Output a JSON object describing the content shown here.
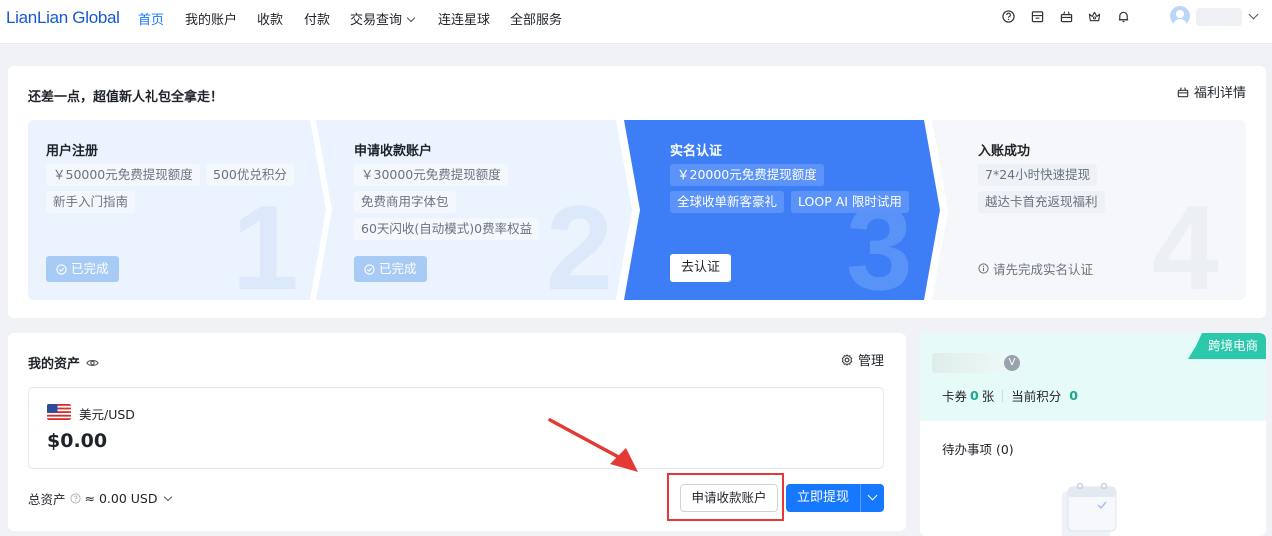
{
  "nav": {
    "logo": "LianLian Global",
    "items": [
      {
        "label": "首页",
        "active": true
      },
      {
        "label": "我的账户"
      },
      {
        "label": "收款"
      },
      {
        "label": "付款"
      },
      {
        "label": "交易查询"
      },
      {
        "label": "连连星球"
      },
      {
        "label": "全部服务"
      }
    ],
    "icons": [
      "help-icon",
      "calendar-icon",
      "gift-icon",
      "crown-icon",
      "bell-icon"
    ]
  },
  "onboard": {
    "title": "还差一点，超值新人礼包全拿走！",
    "welfare_label": "福利详情",
    "steps": [
      {
        "title": "用户注册",
        "tags": [
          "￥50000元免费提现额度",
          "500优兑积分",
          "新手入门指南"
        ],
        "status": "已完成",
        "num": "1"
      },
      {
        "title": "申请收款账户",
        "tags": [
          "￥30000元免费提现额度",
          "免费商用字体包",
          "60天闪收(自动模式)0费率权益"
        ],
        "status": "已完成",
        "num": "2"
      },
      {
        "title": "实名认证",
        "tags": [
          "￥20000元免费提现额度",
          "全球收单新客豪礼",
          "LOOP AI 限时试用"
        ],
        "action": "去认证",
        "num": "3"
      },
      {
        "title": "入账成功",
        "tags": [
          "7*24小时快速提现",
          "越达卡首充返现福利"
        ],
        "hint": "请先完成实名认证",
        "num": "4"
      }
    ]
  },
  "assets": {
    "title": "我的资产",
    "manage_label": "管理",
    "currency": "美元/USD",
    "amount": "$0.00",
    "total_label": "总资产",
    "total_value": "≈ 0.00 USD",
    "apply_button": "申请收款账户",
    "withdraw_button": "立即提现"
  },
  "rightpanel": {
    "badge": "跨境电商",
    "v_label": "V",
    "coupon_label": "卡券",
    "coupon_value": "0",
    "coupon_unit": "张",
    "points_label": "当前积分",
    "points_value": "0",
    "todo_label": "待办事项 (0)"
  },
  "colors": {
    "primary": "#1677ff",
    "active_step": "#3d7ef7",
    "done_step": "#eaf3fe",
    "pending_step": "#f5f7fa",
    "teal": "#2cc8ac",
    "annotation": "#e53935"
  }
}
